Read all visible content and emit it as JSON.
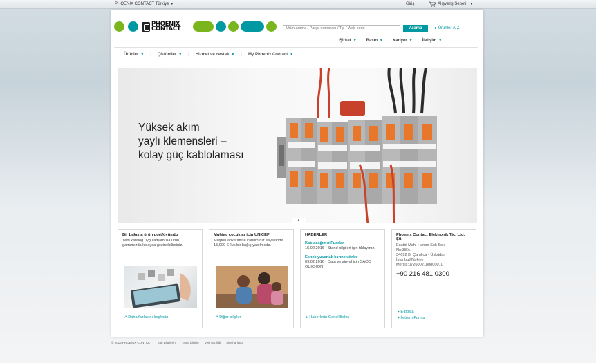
{
  "topbar": {
    "country": "PHOENIX CONTACT Türkiye",
    "login": "Giriş",
    "cart": "Alışveriş Sepeti"
  },
  "logo": {
    "line1": "PHOENIX",
    "line2": "CONTACT"
  },
  "brand_colors": {
    "green": "#7ab51d",
    "teal": "#0098a1",
    "dark_teal": "#005f66"
  },
  "search": {
    "placeholder": "Ürün arama / Parça numarası / Tip / Web kodu",
    "button": "Arama",
    "products_az": "Ürünler A-Z"
  },
  "utility_nav": [
    "Şirket",
    "Basın",
    "Kariyer",
    "İletişim"
  ],
  "main_nav": [
    "Ürünler",
    "Çözümler",
    "Hizmet ve destek",
    "My Phoenix Contact"
  ],
  "hero": {
    "line1": "Yüksek akım",
    "line2": "yaylı klemensleri –",
    "line3": "kolay güç kablolaması"
  },
  "boxes": [
    {
      "title": "Bir bakışta ürün portföyümüz",
      "text": "Yeni katalog uygulamamızla ürün gamımızda kolayca gezinebilirsiniz.",
      "link": "Daha fazlasını keşfedin",
      "image_icon": "catalog-app-image"
    },
    {
      "title": "Muhtaç çocuklar için UNICEF",
      "text": "Müşteri anketimize katılımınız sayesinde 15,000 € 'luk bir bağış yapılmıştır.",
      "link": "Diğer bilgiler",
      "image_icon": "children-photo"
    },
    {
      "title": "HABERLER",
      "news": [
        {
          "heading": "Katılacağımız Fuarlar",
          "text": "15.02.2016 - Stand bilgileri için tıklayınız."
        },
        {
          "heading": "Esnek yuvarlak konnektörler",
          "text": "09.02.2016 - Data ve sinyal için SACC QUICKON"
        }
      ],
      "link": "Haberlerin Genel Bakış"
    },
    {
      "title": "Phoenix Contact Elektronik Tic. Ltd. Şti.",
      "address": [
        "Esatbi Mah. Hanım Sok Sok.",
        "No:38/A",
        "34692 B. Çamlıca - Üsküdar",
        "İstanbul/Türkiye",
        "Mersis:0726002180800010"
      ],
      "phone": "+90 216 481 0300",
      "links": [
        "E-posta",
        "İletişim Formu"
      ]
    }
  ],
  "footer": [
    "© 2016 PHOENIX CONTACT",
    "Site Bilgilerini",
    "Yasal bilgiler",
    "Veri Gizliliği",
    "Site haritası"
  ]
}
